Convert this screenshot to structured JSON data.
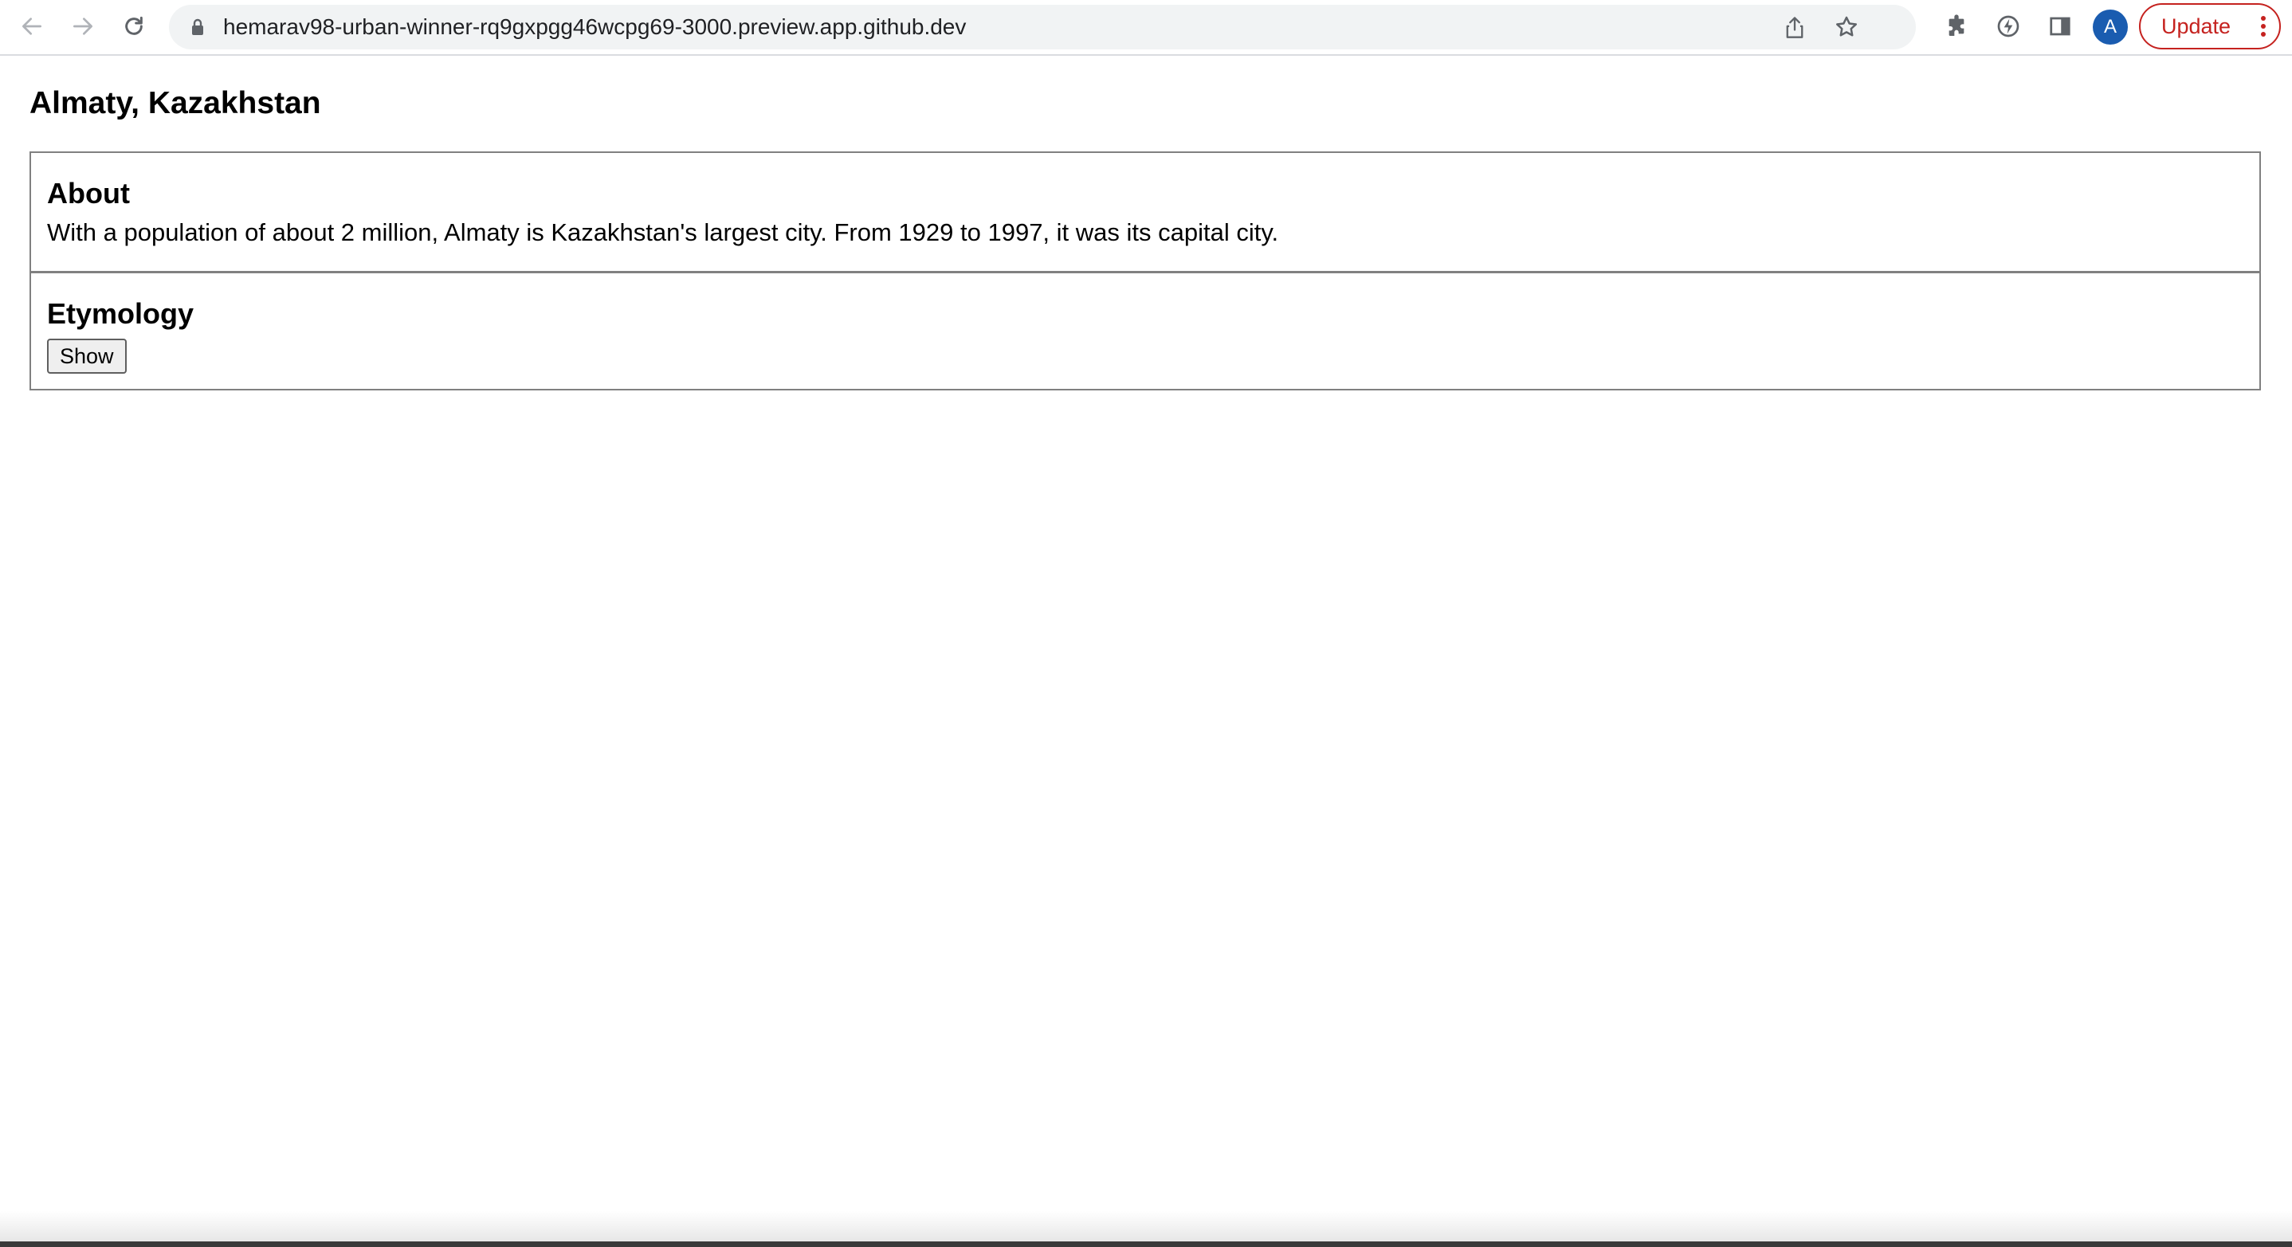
{
  "browser": {
    "url": "hemarav98-urban-winner-rq9gxpgg46wcpg69-3000.preview.app.github.dev",
    "profile_initial": "A",
    "update_label": "Update",
    "icons": {
      "back": "arrow-left-icon",
      "forward": "arrow-right-icon",
      "reload": "reload-icon",
      "lock": "lock-icon",
      "share": "share-icon",
      "bookmark": "star-icon",
      "extensions": "puzzle-icon",
      "performance": "lightning-icon",
      "side_panel": "side-panel-icon",
      "menu": "three-dots-icon"
    },
    "colors": {
      "omnibox_bg": "#f1f3f4",
      "avatar_bg": "#1a5cb0",
      "update_accent": "#c5221f"
    }
  },
  "page": {
    "title": "Almaty, Kazakhstan",
    "about": {
      "heading": "About",
      "text": "With a population of about 2 million, Almaty is Kazakhstan's largest city. From 1929 to 1997, it was its capital city."
    },
    "etymology": {
      "heading": "Etymology",
      "button_label": "Show"
    }
  }
}
